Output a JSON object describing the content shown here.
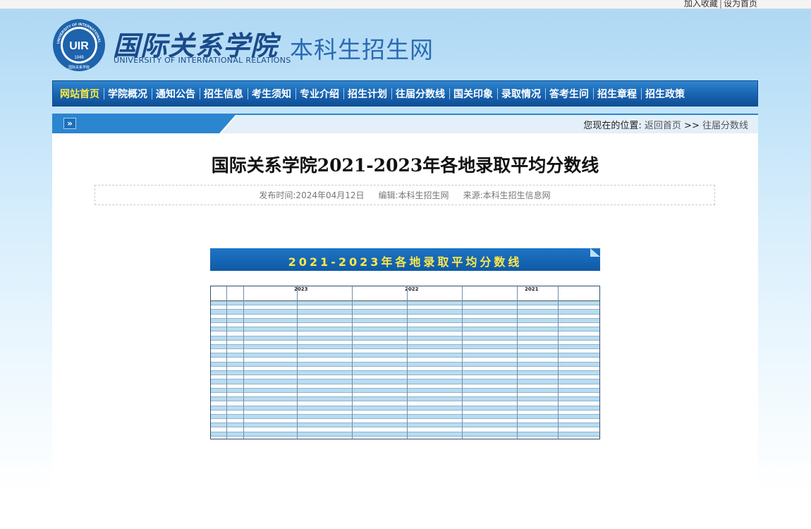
{
  "topbar": {
    "favorite_label": "加入收藏",
    "homepage_label": "设为首页"
  },
  "header": {
    "cn_name": "国际关系学院",
    "en_name": "UNIVERSITY OF INTERNATIONAL RELATIONS",
    "site_name": "本科生招生网",
    "logo": {
      "center_text": "UIR",
      "year": "1949",
      "ring_text": "UNIVERSITY OF INTERNATIONAL RELATIONS",
      "bottom_text": "国际关系学院"
    }
  },
  "nav": {
    "items": [
      {
        "label": "网站首页",
        "active": true
      },
      {
        "label": "学院概况"
      },
      {
        "label": "通知公告"
      },
      {
        "label": "招生信息"
      },
      {
        "label": "考生须知"
      },
      {
        "label": "专业介绍"
      },
      {
        "label": "招生计划"
      },
      {
        "label": "往届分数线"
      },
      {
        "label": "国关印象"
      },
      {
        "label": "录取情况"
      },
      {
        "label": "答考生问"
      },
      {
        "label": "招生章程"
      },
      {
        "label": "招生政策"
      }
    ]
  },
  "breadcrumb": {
    "prefix": "您现在的位置:",
    "home": "返回首页",
    "separator": ">>",
    "current": "往届分数线"
  },
  "article": {
    "title": "国际关系学院2021-2023年各地录取平均分数线",
    "publish_time": "发布时间:2024年04月12日",
    "editor": "编辑:本科生招生网",
    "source": "来源:本科生招生信息网"
  },
  "scan_image": {
    "banner_title": "2021-2023年各地录取平均分数线",
    "years": [
      "2023",
      "2022",
      "2021"
    ]
  },
  "colors": {
    "nav_active": "#ffea3a",
    "brand_blue": "#1a66b3"
  }
}
